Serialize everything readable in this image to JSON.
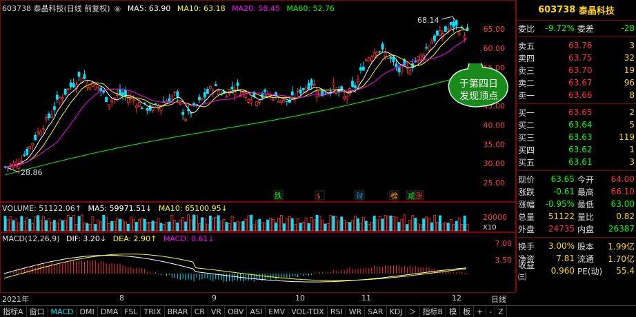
{
  "stock": {
    "code": "603738",
    "name": "泰晶科技"
  },
  "header": {
    "title": "603738 泰晶科技(日线 前复权)",
    "ma5": "MA5: 63.90",
    "ma10": "MA10: 63.18",
    "ma20": "MA20: 58.45",
    "ma60": "MA60: 52.76"
  },
  "colors": {
    "ma5": "#ffffff",
    "ma10": "#ffff00",
    "ma20": "#ff00ff",
    "ma60": "#00ff00",
    "up": "#ff3232",
    "down": "#00e5ff"
  },
  "price_chart": {
    "high_label": "68.14",
    "low_label": "28.86",
    "yticks": [
      "65.00",
      "60.00",
      "55.00",
      "50.00",
      "45.00",
      "40.00",
      "35.00",
      "30.00",
      "25.00"
    ],
    "tags": [
      {
        "text": "跌",
        "color": "#00ff00"
      },
      {
        "text": "$",
        "color": "#ff3232"
      },
      {
        "text": "财",
        "color": "#00b0ff"
      },
      {
        "text": "榜",
        "color": "#ffa500"
      },
      {
        "text": "减",
        "color": "#00ff00"
      },
      {
        "text": "涨",
        "color": "#ff3232"
      }
    ]
  },
  "callout": {
    "line1": "于第四日",
    "line2": "发现顶点"
  },
  "volume": {
    "label": "VOLUME: 51122.06↑",
    "ma5": "MA5: 59971.51↓",
    "ma10": "MA10: 65100.95↓",
    "ytick": "20000",
    "unit": "X10"
  },
  "macd": {
    "label": "MACD(12,26,9)",
    "dif": "DIF: 3.20↓",
    "dea": "DEA: 2.90↑",
    "macd": "MACD: 0.61↓",
    "yticks": [
      "7.00",
      "3.50"
    ]
  },
  "dates": [
    "2021年",
    "8",
    "9",
    "10",
    "11",
    "12"
  ],
  "period": "日线",
  "quote": {
    "weibi": {
      "l": "委比",
      "v": "-9.72%",
      "l2": "委差",
      "v2": "-28"
    },
    "sells": [
      {
        "l": "卖五",
        "p": "63.76",
        "q": "3"
      },
      {
        "l": "卖四",
        "p": "63.75",
        "q": "32"
      },
      {
        "l": "卖三",
        "p": "63.70",
        "q": "19"
      },
      {
        "l": "卖二",
        "p": "63.67",
        "q": "96"
      },
      {
        "l": "卖一",
        "p": "63.66",
        "q": "8"
      }
    ],
    "buys": [
      {
        "l": "买一",
        "p": "63.65",
        "q": "2"
      },
      {
        "l": "买二",
        "p": "63.64",
        "q": "5"
      },
      {
        "l": "买三",
        "p": "63.63",
        "q": "119"
      },
      {
        "l": "买四",
        "p": "63.62",
        "q": "1"
      },
      {
        "l": "买五",
        "p": "63.61",
        "q": "3"
      }
    ],
    "stats": [
      {
        "l": "现价",
        "v": "63.65",
        "l2": "今开",
        "v2": "64.00"
      },
      {
        "l": "涨跌",
        "v": "-0.61",
        "l2": "最高",
        "v2": "66.10"
      },
      {
        "l": "涨幅",
        "v": "-0.95%",
        "l2": "最低",
        "v2": "63.00"
      },
      {
        "l": "总量",
        "v": "51122",
        "l2": "量比",
        "v2": "0.82"
      },
      {
        "l": "外盘",
        "v": "24735",
        "l2": "内盘",
        "v2": "26387"
      }
    ],
    "stats2": [
      {
        "l": "换手",
        "v": "3.00%",
        "l2": "股本",
        "v2": "1.99亿"
      },
      {
        "l": "净资",
        "v": "7.81",
        "l2": "流通",
        "v2": "1.70亿"
      },
      {
        "l": "收益㈢",
        "v": "0.960",
        "l2": "PE(动)",
        "v2": "55.4"
      }
    ]
  },
  "tabs": [
    "指标A",
    "窗口",
    "MACD",
    "DMI",
    "DMA",
    "FSL",
    "TRIX",
    "BRAR",
    "CR",
    "VR",
    "OBV",
    "ASI",
    "EMV",
    "VOL-TDX",
    "RSI",
    "WR",
    "SAR",
    "KDJ",
    "＞",
    "指标B",
    "模",
    "板",
    "+",
    "-",
    "Z"
  ]
}
